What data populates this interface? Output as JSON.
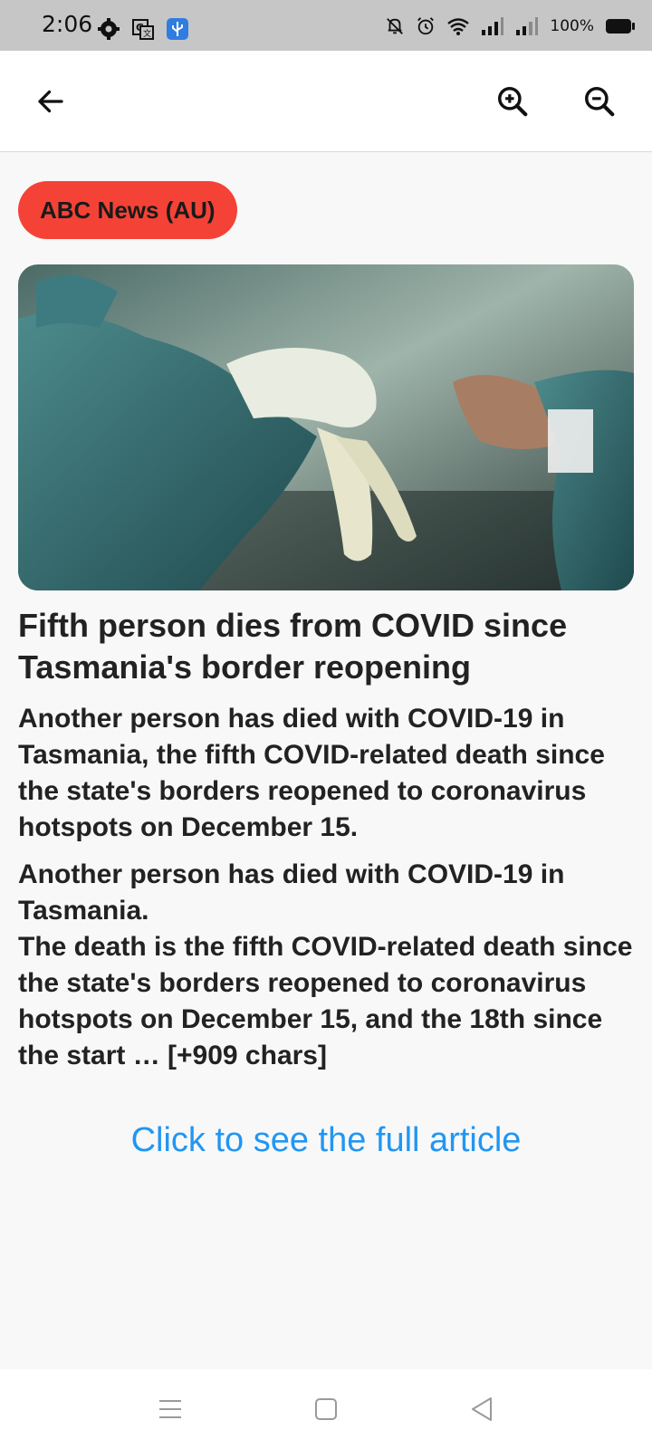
{
  "status_bar": {
    "time": "2:06",
    "battery": "100%",
    "icons": [
      "settings-gear-icon",
      "translate-icon",
      "usb-icon",
      "bell-off-icon",
      "alarm-icon",
      "wifi-icon",
      "signal-icon",
      "signal-icon",
      "battery-icon"
    ]
  },
  "toolbar": {
    "back_icon": "arrow-left-icon",
    "zoom_in_icon": "zoom-in-icon",
    "zoom_out_icon": "zoom-out-icon"
  },
  "article": {
    "source": "ABC News (AU)",
    "title": "Fifth person dies from COVID since Tasmania's border reopening",
    "description": "Another person has died with COVID-19 in Tasmania, the fifth COVID-related death since the state's borders reopened to coronavirus hotspots on December 15.",
    "content_line1": "Another person has died with COVID-19 in Tasmania.",
    "content_line2": "The death is the fifth COVID-related death since the state's borders reopened to coronavirus hotspots on December 15, and the 18th since the start … [+909 chars]",
    "link_text": "Click to see the full article"
  },
  "colors": {
    "chip": "#f44336",
    "link": "#2196f3",
    "status_bar": "#c6c6c6"
  }
}
